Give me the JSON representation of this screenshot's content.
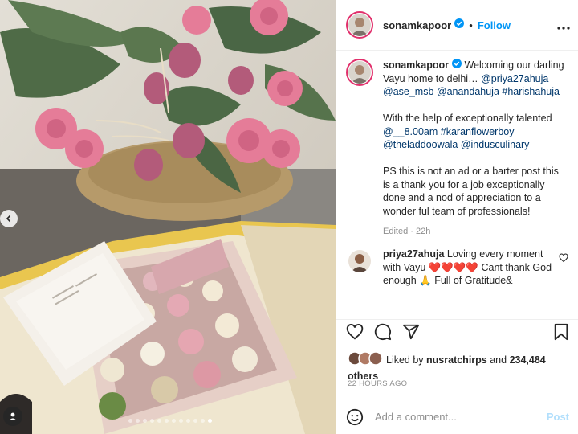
{
  "post": {
    "username": "sonamkapoor",
    "follow_label": "Follow",
    "dot": "•"
  },
  "caption": {
    "username": "sonamkapoor",
    "line1": " Welcoming our darling Vayu home to delhi… ",
    "mentions1": "@priya27ahuja @ase_msb @anandahuja #harishahuja",
    "line2": "With the help of exceptionally talented ",
    "mentions2": "@__8.00am #karanflowerboy @theladdoowala @indusculinary",
    "line3": "PS this is not an ad or a barter post this is a thank you for a job exceptionally done and a nod of appreciation to a wonder ful team of professionals!",
    "edited": "Edited · 22h"
  },
  "comment": {
    "username": "priya27ahuja",
    "text": " Loving every moment with Vayu ❤️❤️❤️❤️ Cant thank God enough 🙏 Full of Gratitude&",
    "text_display_1": " Loving every moment with Vayu ",
    "text_display_2": " Cant thank God enough ",
    "text_display_3": " Full of Gratitude&"
  },
  "likes": {
    "prefix": "Liked by ",
    "user": "nusratchirps",
    "and": " and ",
    "count": "234,484",
    "suffix": "others"
  },
  "time_ago": "22 HOURS AGO",
  "add_comment": {
    "placeholder": "Add a comment...",
    "post_label": "Post"
  },
  "colors": {
    "accent": "#0095f6",
    "heart": "#ed4956",
    "post_disabled": "#b2dffc"
  },
  "icons": [
    "verified-badge-icon",
    "more-options-icon",
    "like-heart-icon",
    "comment-icon",
    "share-icon",
    "save-bookmark-icon",
    "emoji-icon",
    "carousel-prev-icon",
    "tag-user-icon"
  ],
  "carousel": {
    "count": 12,
    "active": 11
  }
}
